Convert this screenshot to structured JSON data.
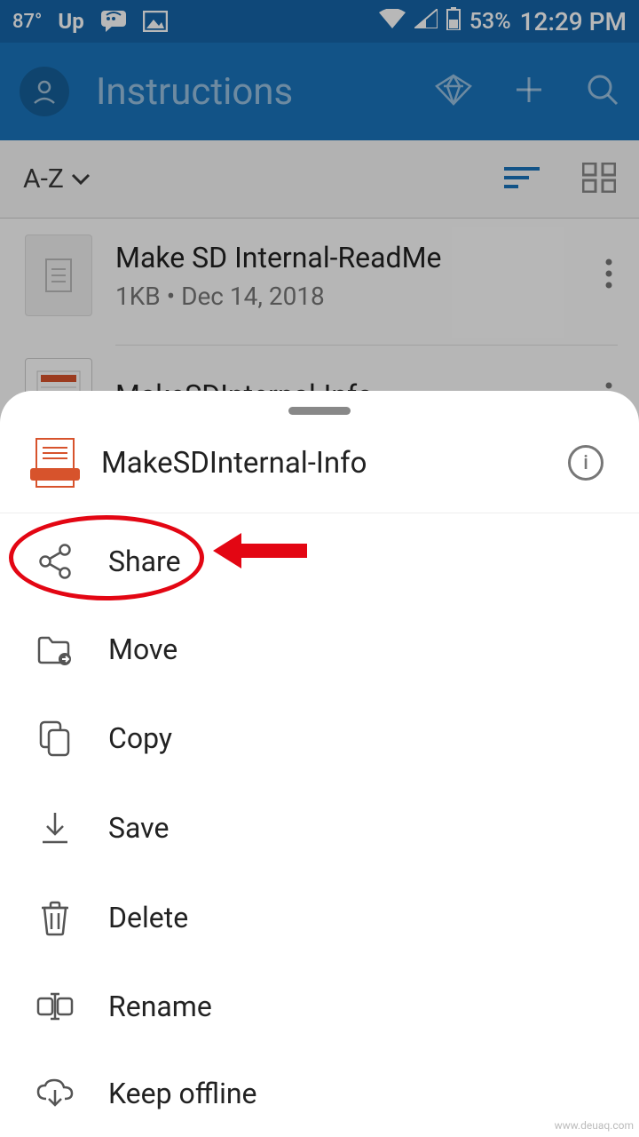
{
  "status": {
    "temp": "87°",
    "upwork": "Up",
    "battery_pct": "53%",
    "time": "12:29 PM"
  },
  "appbar": {
    "title": "Instructions"
  },
  "sortbar": {
    "label": "A-Z"
  },
  "files": [
    {
      "title": "Make SD Internal-ReadMe",
      "meta": "1KB • Dec 14, 2018"
    },
    {
      "title": "MakeSDInternal-Info",
      "meta": ""
    }
  ],
  "sheet": {
    "filename": "MakeSDInternal-Info",
    "actions": {
      "share": "Share",
      "move": "Move",
      "copy": "Copy",
      "save": "Save",
      "delete": "Delete",
      "rename": "Rename",
      "keep_offline": "Keep offline"
    }
  },
  "watermark": "www.deuaq.com"
}
